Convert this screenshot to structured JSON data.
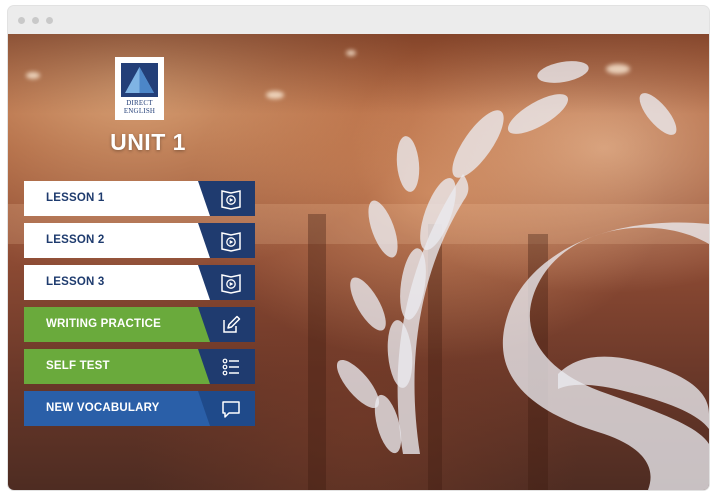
{
  "logo": {
    "line1": "DIRECT",
    "line2": "ENGLISH"
  },
  "unit": {
    "title": "UNIT 1"
  },
  "menu": [
    {
      "label": "LESSON 1",
      "icon": "book-play-icon",
      "style": "lesson"
    },
    {
      "label": "LESSON 2",
      "icon": "book-play-icon",
      "style": "lesson"
    },
    {
      "label": "LESSON 3",
      "icon": "book-play-icon",
      "style": "lesson"
    },
    {
      "label": "WRITING PRACTICE",
      "icon": "pencil-edit-icon",
      "style": "practice"
    },
    {
      "label": "SELF TEST",
      "icon": "checklist-icon",
      "style": "practice"
    },
    {
      "label": "NEW VOCABULARY",
      "icon": "speech-bubble-icon",
      "style": "vocab"
    }
  ],
  "colors": {
    "navy": "#1f3b6f",
    "green": "#6aaa3c",
    "green_dark": "#4f8f2c",
    "blue": "#2a5fa8",
    "blue_dark": "#1f4a8a",
    "white": "#ffffff"
  }
}
